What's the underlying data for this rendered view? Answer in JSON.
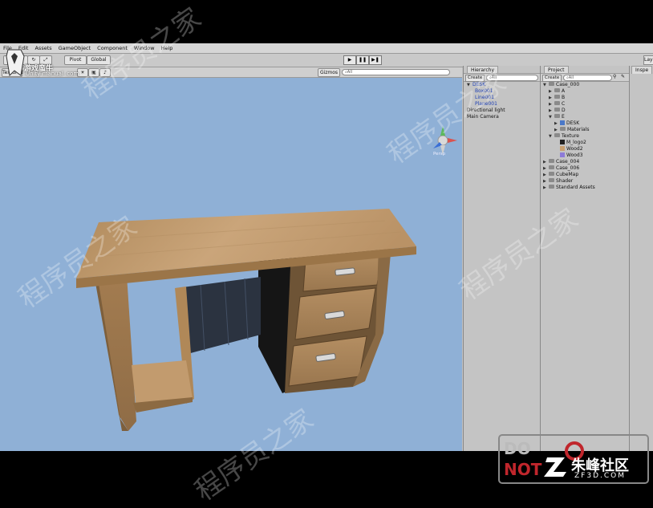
{
  "menu": [
    "File",
    "Edit",
    "Assets",
    "GameObject",
    "Component",
    "Window",
    "Help"
  ],
  "toolbar": {
    "pivot_label": "Pivot",
    "global_label": "Global",
    "play_icon": "play-icon",
    "pause_icon": "pause-icon",
    "step_icon": "step-icon",
    "layers_label": "Layers"
  },
  "scene": {
    "mode_label": "Textured",
    "gizmos_label": "Gizmos",
    "search_placeholder": "⌕All",
    "persp_label": "Persp"
  },
  "hierarchy": {
    "tab_label": "Hierarchy",
    "create_label": "Create",
    "search_placeholder": "⌕All",
    "items": [
      {
        "label": "DESK",
        "indent": 0,
        "blue": true,
        "expanded": true
      },
      {
        "label": "Box001",
        "indent": 1,
        "blue": true
      },
      {
        "label": "Line001",
        "indent": 1,
        "blue": true
      },
      {
        "label": "Plane001",
        "indent": 1,
        "blue": true
      },
      {
        "label": "Directional light",
        "indent": 0,
        "blue": false
      },
      {
        "label": "Main Camera",
        "indent": 0,
        "blue": false
      }
    ]
  },
  "project": {
    "tab_label": "Project",
    "create_label": "Create",
    "search_placeholder": "⌕All",
    "items": [
      {
        "label": "Case_000",
        "indent": 0,
        "type": "folder",
        "open": true
      },
      {
        "label": "A",
        "indent": 1,
        "type": "folder"
      },
      {
        "label": "B",
        "indent": 1,
        "type": "folder"
      },
      {
        "label": "C",
        "indent": 1,
        "type": "folder"
      },
      {
        "label": "D",
        "indent": 1,
        "type": "folder"
      },
      {
        "label": "E",
        "indent": 1,
        "type": "folder",
        "open": true
      },
      {
        "label": "DESK",
        "indent": 2,
        "type": "prefab"
      },
      {
        "label": "Materials",
        "indent": 2,
        "type": "folder"
      },
      {
        "label": "Texture",
        "indent": 1,
        "type": "folder",
        "open": true
      },
      {
        "label": "M_logo2",
        "indent": 2,
        "type": "texture",
        "color": "#222222"
      },
      {
        "label": "Wood2",
        "indent": 2,
        "type": "texture",
        "color": "#c9a070"
      },
      {
        "label": "Wood3",
        "indent": 2,
        "type": "texture",
        "color": "#8d7bd8"
      },
      {
        "label": "Case_004",
        "indent": 0,
        "type": "folder"
      },
      {
        "label": "Case_006",
        "indent": 0,
        "type": "folder"
      },
      {
        "label": "CubeMap",
        "indent": 0,
        "type": "folder"
      },
      {
        "label": "Shader",
        "indent": 0,
        "type": "folder"
      },
      {
        "label": "Standard Assets",
        "indent": 0,
        "type": "folder"
      }
    ]
  },
  "inspector": {
    "tab_label": "Inspe"
  },
  "branding": {
    "top_logo_text": "游戏蛮牛",
    "top_logo_sub": "Unity manual .com",
    "watermark": "程序员之家",
    "bottom_logo": "朱峰社区",
    "bottom_sub": "ZF3D.COM",
    "do_not": "DO NOT"
  },
  "colors": {
    "scene_bg": "#8fb0d6",
    "wood": "#c49a6a",
    "panel_bg": "#c4c4c4"
  }
}
